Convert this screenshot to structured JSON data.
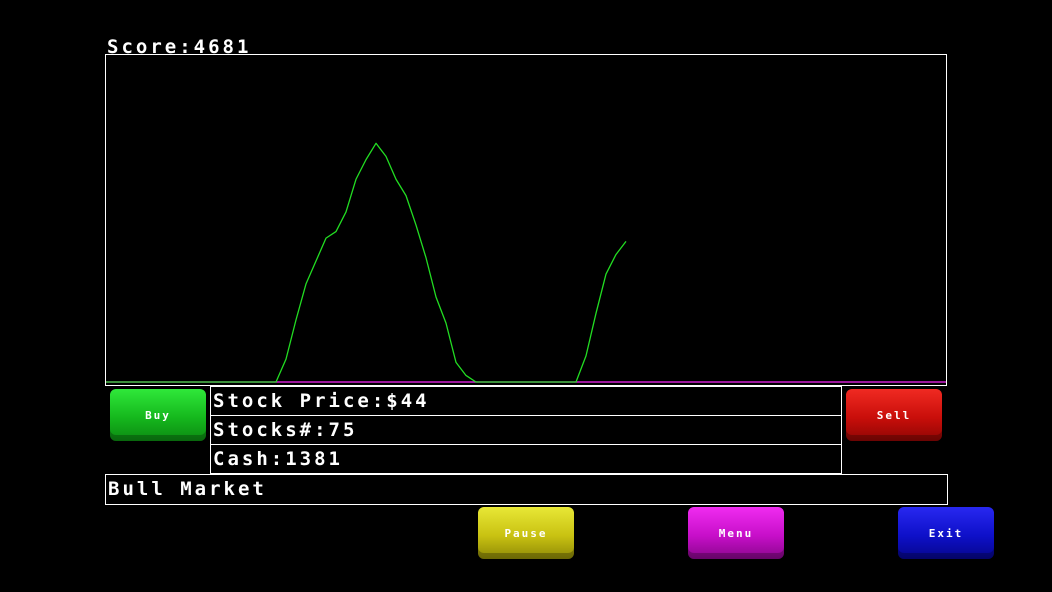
{
  "score_text": "Score:4681",
  "stats": {
    "price_text": "Stock Price:$44",
    "stocks_text": "Stocks#:75",
    "cash_text": "Cash:1381"
  },
  "market_text": "Bull Market",
  "buttons": {
    "buy": "Buy",
    "sell": "Sell",
    "pause": "Pause",
    "menu": "Menu",
    "exit": "Exit"
  },
  "colors": {
    "price_line": "#22dd22",
    "baseline": "#d020d0",
    "border": "#ffffff",
    "background": "#000000"
  },
  "chart_data": {
    "type": "line",
    "xlim": [
      0,
      84
    ],
    "ylim": [
      0,
      100
    ],
    "grid": false,
    "series": [
      {
        "values": [
          0,
          0,
          0,
          0,
          0,
          0,
          0,
          0,
          0,
          0,
          0,
          0,
          0,
          0,
          0,
          0,
          0,
          0,
          7,
          19,
          30,
          37,
          44,
          46,
          52,
          62,
          68,
          73,
          69,
          62,
          57,
          48,
          38,
          26,
          18,
          6,
          2,
          0,
          0,
          0,
          0,
          0,
          0,
          0,
          0,
          0,
          0,
          0,
          8,
          21,
          33,
          39,
          43
        ]
      }
    ]
  }
}
